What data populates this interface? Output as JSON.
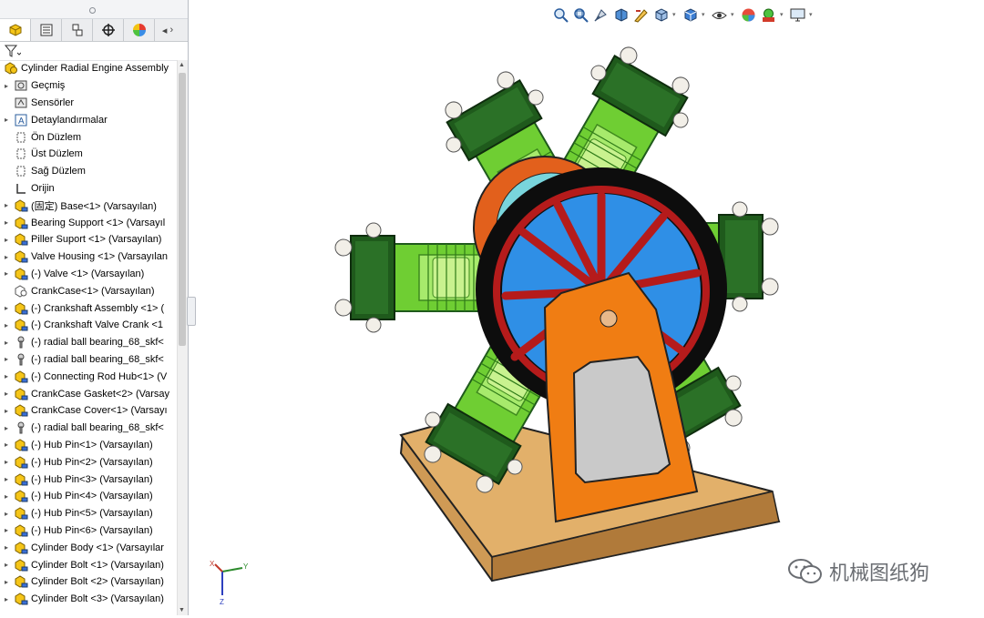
{
  "feature_tree": {
    "root": {
      "label": "Cylinder Radial Engine Assembly",
      "icon": "assembly-icon"
    },
    "items": [
      {
        "label": "Geçmiş",
        "icon": "history-folder-icon",
        "expander": true
      },
      {
        "label": "Sensörler",
        "icon": "sensor-folder-icon",
        "expander": false
      },
      {
        "label": "Detaylandırmalar",
        "icon": "annotations-icon",
        "expander": true
      },
      {
        "label": "Ön Düzlem",
        "icon": "plane-icon",
        "expander": false
      },
      {
        "label": "Üst Düzlem",
        "icon": "plane-icon",
        "expander": false
      },
      {
        "label": "Sağ Düzlem",
        "icon": "plane-icon",
        "expander": false
      },
      {
        "label": "Orijin",
        "icon": "origin-icon",
        "expander": false
      },
      {
        "label": "(固定) Base<1> (Varsayılan)",
        "icon": "part-icon",
        "expander": true
      },
      {
        "label": "Bearing Support <1> (Varsayıl",
        "icon": "part-icon",
        "expander": true
      },
      {
        "label": "Piller Suport <1> (Varsayılan)",
        "icon": "part-icon",
        "expander": true
      },
      {
        "label": "Valve Housing <1> (Varsayılan",
        "icon": "part-icon",
        "expander": true
      },
      {
        "label": "(-) Valve <1> (Varsayılan)",
        "icon": "part-icon",
        "expander": true
      },
      {
        "label": "CrankCase<1> (Varsayılan)",
        "icon": "subassembly-icon",
        "expander": false
      },
      {
        "label": "(-) Crankshaft Assembly <1> (",
        "icon": "part-icon",
        "expander": true
      },
      {
        "label": "(-) Crankshaft Valve Crank <1",
        "icon": "part-icon",
        "expander": true
      },
      {
        "label": "(-) radial ball bearing_68_skf<",
        "icon": "toolbox-icon",
        "expander": true
      },
      {
        "label": "(-) radial ball bearing_68_skf<",
        "icon": "toolbox-icon",
        "expander": true
      },
      {
        "label": "(-) Connecting Rod Hub<1> (V",
        "icon": "part-icon",
        "expander": true
      },
      {
        "label": "CrankCase Gasket<2> (Varsay",
        "icon": "part-icon",
        "expander": true
      },
      {
        "label": "CrankCase Cover<1> (Varsayı",
        "icon": "part-icon",
        "expander": true
      },
      {
        "label": "(-) radial ball bearing_68_skf<",
        "icon": "toolbox-icon",
        "expander": true
      },
      {
        "label": "(-) Hub Pin<1> (Varsayılan)",
        "icon": "part-icon",
        "expander": true
      },
      {
        "label": "(-) Hub Pin<2> (Varsayılan)",
        "icon": "part-icon",
        "expander": true
      },
      {
        "label": "(-) Hub Pin<3> (Varsayılan)",
        "icon": "part-icon",
        "expander": true
      },
      {
        "label": "(-) Hub Pin<4> (Varsayılan)",
        "icon": "part-icon",
        "expander": true
      },
      {
        "label": "(-) Hub Pin<5> (Varsayılan)",
        "icon": "part-icon",
        "expander": true
      },
      {
        "label": "(-) Hub Pin<6> (Varsayılan)",
        "icon": "part-icon",
        "expander": true
      },
      {
        "label": "Cylinder Body <1> (Varsayılar",
        "icon": "part-icon",
        "expander": true
      },
      {
        "label": "Cylinder Bolt <1> (Varsayılan)",
        "icon": "part-icon",
        "expander": true
      },
      {
        "label": "Cylinder Bolt <2> (Varsayılan)",
        "icon": "part-icon",
        "expander": true
      },
      {
        "label": "Cylinder Bolt <3> (Varsayılan)",
        "icon": "part-icon",
        "expander": true
      }
    ]
  },
  "manager_tabs": [
    "featuremanager-tab",
    "propertymanager-tab",
    "configurationmanager-tab",
    "dimxpert-tab",
    "display-manager-tab"
  ],
  "heads_up_toolbar": [
    "zoom-to-fit-icon",
    "zoom-to-area-icon",
    "previous-view-icon",
    "section-view-icon",
    "dynamic-annotation-icon",
    "view-orientation-icon",
    "display-style-icon",
    "hide-show-icon",
    "edit-appearance-icon",
    "apply-scene-icon",
    "view-settings-icon"
  ],
  "watermark": {
    "text": "机械图纸狗"
  },
  "triad": {
    "x": "X",
    "y": "Y",
    "z": "Z"
  },
  "colors": {
    "accent_blue": "#3d7fd4",
    "cylinder_green": "#7fd63a",
    "cylinder_dark": "#1f5a1c",
    "flywheel_black": "#0d0d0d",
    "spoke_red": "#b51b1b",
    "hub_blue": "#2f8fe6",
    "support_orange": "#f07d13",
    "base_wood": "#cf9a55"
  }
}
